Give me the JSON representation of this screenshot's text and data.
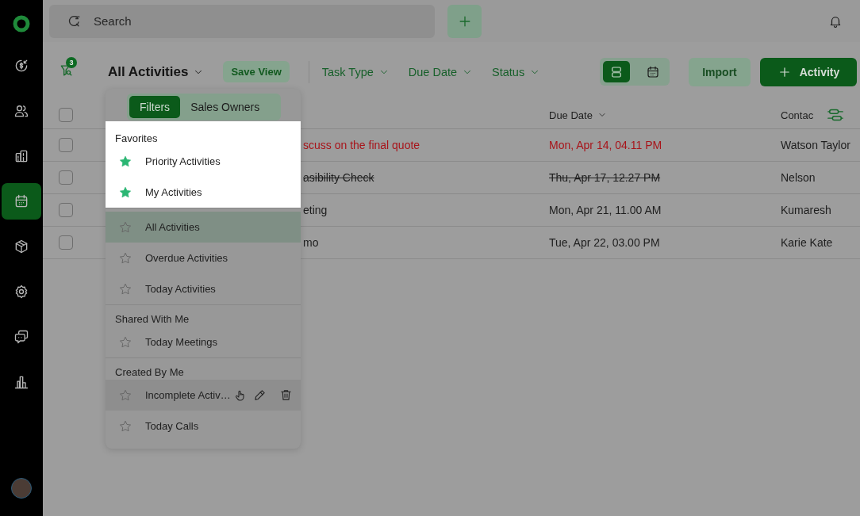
{
  "sidebar": {
    "items": [
      {
        "selected": false
      },
      {
        "selected": false
      },
      {
        "selected": false
      },
      {
        "selected": true
      },
      {
        "selected": false
      },
      {
        "selected": false
      },
      {
        "selected": false
      },
      {
        "selected": false
      }
    ]
  },
  "search": {
    "placeholder": "Search"
  },
  "toolbar": {
    "filter_count": "3",
    "view_title": "All Activities",
    "save_view": "Save View",
    "filters": [
      {
        "label": "Task Type"
      },
      {
        "label": "Due Date"
      },
      {
        "label": "Status"
      }
    ],
    "view_toggle": [
      {
        "selected": true
      },
      {
        "selected": false
      }
    ],
    "import": "Import",
    "add": "Activity"
  },
  "table": {
    "select_all_checked": false,
    "columns": [
      {
        "label": "Due Date"
      },
      {
        "label": "Contac"
      }
    ],
    "rows": [
      {
        "title": "scuss on the final quote",
        "due": "Mon, Apr 14, 04.11 PM",
        "contact": "Watson Taylor",
        "kind": "overdue",
        "checked": false
      },
      {
        "title": "asibility Check",
        "due": "Thu, Apr 17, 12.27 PM",
        "contact": "Nelson",
        "kind": "completed",
        "checked": false
      },
      {
        "title": "eting",
        "due": "Mon, Apr 21, 11.00 AM",
        "contact": "Kumaresh",
        "kind": "normal",
        "checked": false
      },
      {
        "title": "mo",
        "due": "Tue, Apr 22, 03.00 PM",
        "contact": "Karie Kate",
        "kind": "normal",
        "checked": false
      }
    ]
  },
  "dropdown": {
    "tabs": [
      {
        "label": "Filters",
        "selected": true
      },
      {
        "label": "Sales Owners",
        "selected": false
      }
    ],
    "sections": [
      {
        "title": "Favorites",
        "highlighted": true,
        "items": [
          {
            "label": "Priority Activities",
            "starred": true,
            "selected": false,
            "hovered": false
          },
          {
            "label": "My Activities",
            "starred": true,
            "selected": false,
            "hovered": false
          }
        ]
      },
      {
        "highlighted": false,
        "items": [
          {
            "label": "All Activities",
            "starred": false,
            "selected": true,
            "hovered": false
          },
          {
            "label": "Overdue Activities",
            "starred": false,
            "selected": false,
            "hovered": false
          },
          {
            "label": "Today Activities",
            "starred": false,
            "selected": false,
            "hovered": false
          }
        ]
      },
      {
        "title": "Shared With Me",
        "highlighted": false,
        "items": [
          {
            "label": "Today Meetings",
            "starred": false,
            "selected": false,
            "hovered": false
          }
        ]
      },
      {
        "title": "Created By Me",
        "highlighted": false,
        "items": [
          {
            "label": "Incomplete Activ…",
            "starred": false,
            "selected": false,
            "hovered": true
          },
          {
            "label": "Today Calls",
            "starred": false,
            "selected": false,
            "hovered": false
          }
        ]
      }
    ]
  }
}
